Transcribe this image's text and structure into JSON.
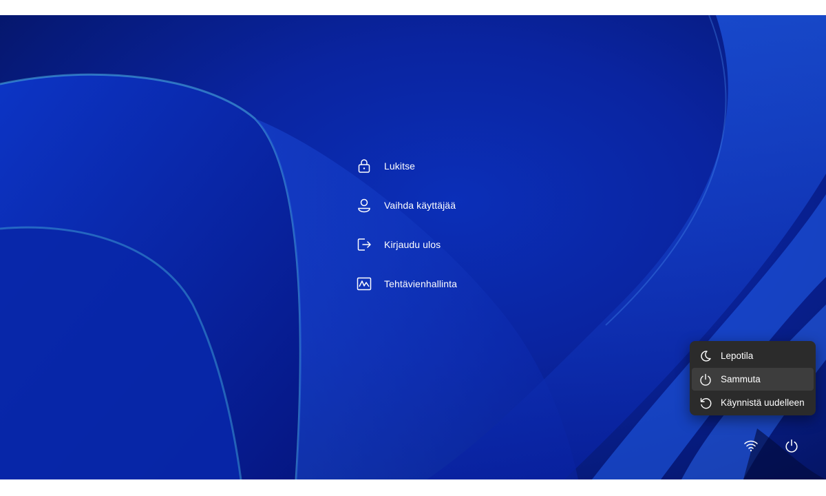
{
  "colors": {
    "wallpaper_base": "#0a24a0",
    "flyout_bg": "#2b2b2b",
    "flyout_hover": "#3d3d3d",
    "text": "#ffffff"
  },
  "options_menu": {
    "items": [
      {
        "icon": "lock-icon",
        "label": "Lukitse"
      },
      {
        "icon": "user-icon",
        "label": "Vaihda käyttäjää"
      },
      {
        "icon": "sign-out-icon",
        "label": "Kirjaudu ulos"
      },
      {
        "icon": "task-manager-icon",
        "label": "Tehtävienhallinta"
      }
    ]
  },
  "power_menu": {
    "items": [
      {
        "icon": "sleep-moon-icon",
        "label": "Lepotila"
      },
      {
        "icon": "power-icon",
        "label": "Sammuta",
        "highlighted": true
      },
      {
        "icon": "restart-icon",
        "label": "Käynnistä uudelleen"
      }
    ]
  },
  "tray": {
    "network_icon": "wifi-icon",
    "power_icon": "power-icon"
  }
}
